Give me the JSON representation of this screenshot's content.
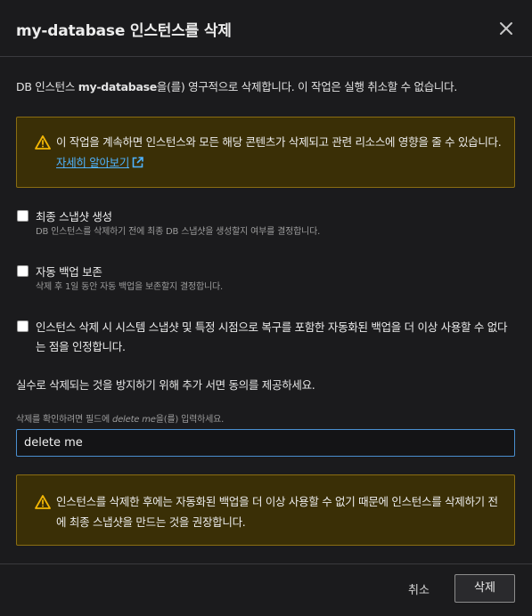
{
  "dialog": {
    "title": "my-database 인스턴스를 삭제",
    "close_icon": "close-icon"
  },
  "description": {
    "prefix": "DB 인스턴스 ",
    "db_name": "my-database",
    "suffix": "을(를) 영구적으로 삭제합니다. 이 작업은 실행 취소할 수 없습니다."
  },
  "alert1": {
    "icon": "warning-icon",
    "text": "이 작업을 계속하면 인스턴스와 모든 해당 콘텐츠가 삭제되고 관련 리소스에 영향을 줄 수 있습니다. ",
    "link_label": "자세히 알아보기",
    "link_icon": "external-link-icon"
  },
  "checkboxes": [
    {
      "label": "최종 스냅샷 생성",
      "description": "DB 인스턴스를 삭제하기 전에 최종 DB 스냅샷을 생성할지 여부를 결정합니다.",
      "checked": false
    },
    {
      "label": "자동 백업 보존",
      "description": "삭제 후 1일 동안 자동 백업을 보존할지 결정합니다.",
      "checked": false
    },
    {
      "label": "인스턴스 삭제 시 시스템 스냅샷 및 특정 시점으로 복구를 포함한 자동화된 백업을 더 이상 사용할 수 없다는 점을 인정합니다.",
      "checked": false
    }
  ],
  "consent": {
    "text": "실수로 삭제되는 것을 방지하기 위해 추가 서면 동의를 제공하세요.",
    "hint_prefix": "삭제를 확인하려면 필드에 ",
    "hint_phrase": "delete me",
    "hint_suffix": "을(를) 입력하세요.",
    "input_value": "delete me"
  },
  "alert2": {
    "icon": "warning-icon",
    "text": "인스턴스를 삭제한 후에는 자동화된 백업을 더 이상 사용할 수 없기 때문에 인스턴스를 삭제하기 전에 최종 스냅샷을 만드는 것을 권장합니다."
  },
  "footer": {
    "cancel_label": "취소",
    "delete_label": "삭제"
  },
  "colors": {
    "background": "#1b1b1d",
    "alert_bg": "#3a2f06",
    "alert_border": "#8a6d12",
    "warning": "#f2b705",
    "link": "#4fb3ff",
    "input_focus": "#4a8fd0"
  }
}
